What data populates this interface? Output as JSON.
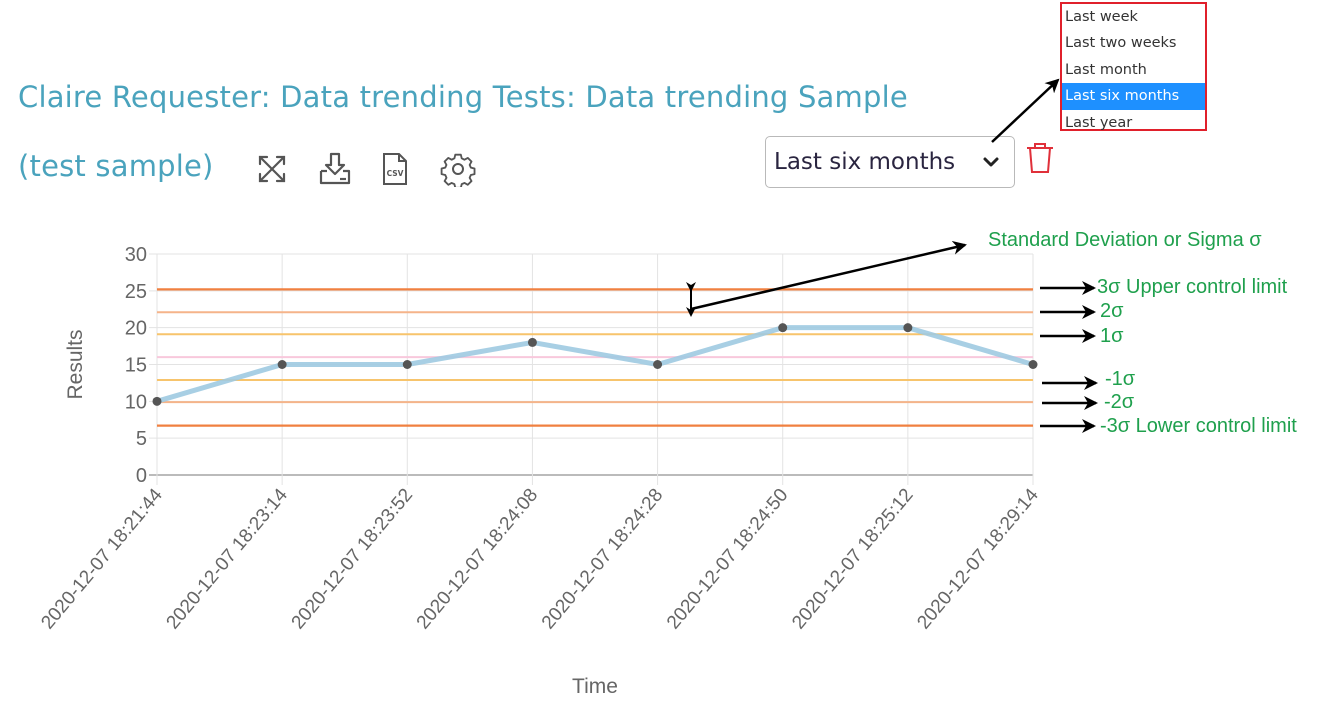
{
  "header": {
    "title_line1": "Claire Requester: Data trending Tests: Data trending Sample",
    "title_line2": "(test sample)",
    "icons": [
      "expand-icon",
      "download-icon",
      "csv-file-icon",
      "gear-icon"
    ]
  },
  "range_select": {
    "selected": "Last six months",
    "options": [
      "Last week",
      "Last two weeks",
      "Last month",
      "Last six months",
      "Last year"
    ],
    "selected_index": 3
  },
  "annotations": {
    "sigma": "Standard Deviation or Sigma σ",
    "ucl": "3σ Upper control limit",
    "p2": "2σ",
    "p1": "1σ",
    "m1": "-1σ",
    "m2": "-2σ",
    "lcl": "-3σ Lower control limit"
  },
  "colors": {
    "title": "#4aa3bd",
    "series": "#9ecae1",
    "point": "#555555",
    "limit3": "#f08040",
    "limit2": "#f5b48a",
    "limit1": "#f7c46c",
    "mean": "#f8c8dc",
    "annotation": "#1fa04d",
    "highlight": "#1e90ff",
    "trash": "#e0303a"
  },
  "chart_data": {
    "type": "line",
    "title": "",
    "xlabel": "Time",
    "ylabel": "Results",
    "ylim": [
      0,
      30
    ],
    "yticks": [
      0,
      5,
      10,
      15,
      20,
      25,
      30
    ],
    "grid": true,
    "categories": [
      "2020-12-07 18:21:44",
      "2020-12-07 18:23:14",
      "2020-12-07 18:23:52",
      "2020-12-07 18:24:08",
      "2020-12-07 18:24:28",
      "2020-12-07 18:24:50",
      "2020-12-07 18:25:12",
      "2020-12-07 18:29:14"
    ],
    "series": [
      {
        "name": "Results",
        "values": [
          10,
          15,
          15,
          18,
          15,
          20,
          20,
          15
        ]
      }
    ],
    "control_lines": [
      {
        "name": "+3σ (UCL)",
        "value": 25.2,
        "color_key": "limit3"
      },
      {
        "name": "+2σ",
        "value": 22.1,
        "color_key": "limit2"
      },
      {
        "name": "+1σ",
        "value": 19.1,
        "color_key": "limit1"
      },
      {
        "name": "mean",
        "value": 16.0,
        "color_key": "mean"
      },
      {
        "name": "-1σ",
        "value": 12.9,
        "color_key": "limit1"
      },
      {
        "name": "-2σ",
        "value": 9.9,
        "color_key": "limit2"
      },
      {
        "name": "-3σ (LCL)",
        "value": 6.7,
        "color_key": "limit3"
      }
    ]
  }
}
